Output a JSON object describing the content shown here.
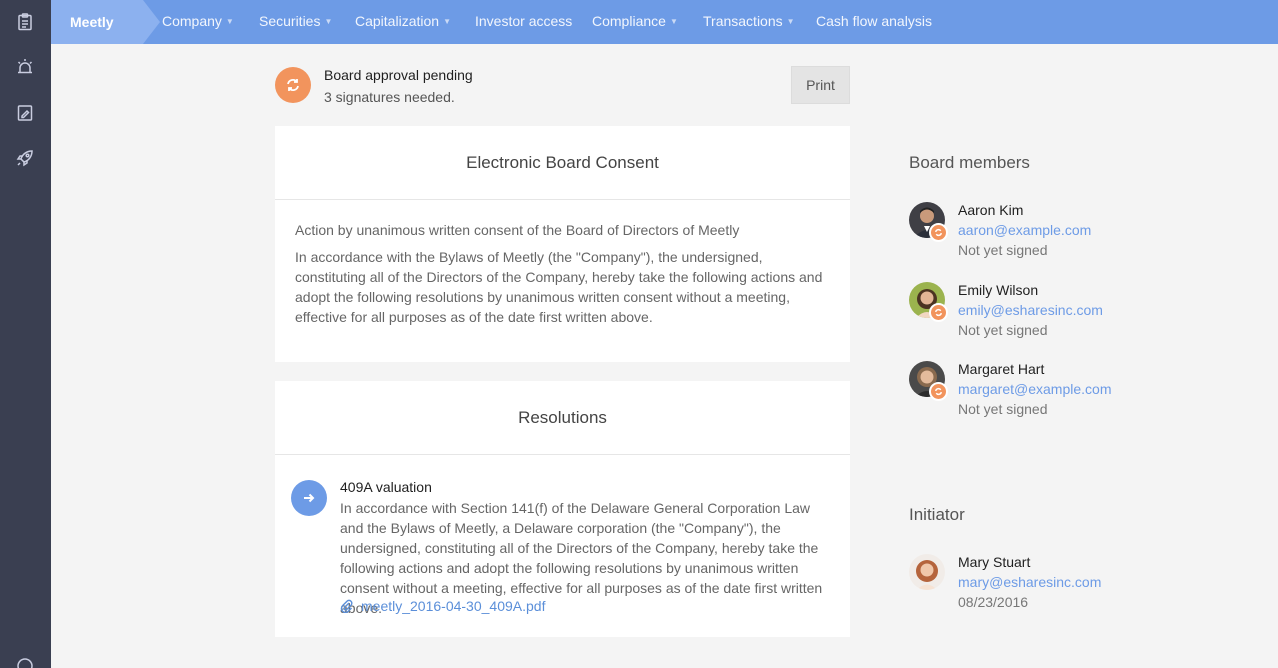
{
  "nav": {
    "brand": "Meetly",
    "items": [
      {
        "label": "Company",
        "dropdown": true
      },
      {
        "label": "Securities",
        "dropdown": true
      },
      {
        "label": "Capitalization",
        "dropdown": true
      },
      {
        "label": "Investor access",
        "dropdown": false
      },
      {
        "label": "Compliance",
        "dropdown": true
      },
      {
        "label": "Transactions",
        "dropdown": true
      },
      {
        "label": "Cash flow analysis",
        "dropdown": false
      }
    ]
  },
  "sidebar": {
    "icons": [
      "clipboard-icon",
      "alarm-icon",
      "document-edit-icon",
      "rocket-icon"
    ]
  },
  "alert": {
    "title": "Board approval pending",
    "subtitle": "3 signatures needed.",
    "print_label": "Print"
  },
  "consent": {
    "title": "Electronic Board Consent",
    "intro": "Action by unanimous written consent of the Board of Directors of Meetly",
    "body": "In accordance with the Bylaws of Meetly (the \"Company\"), the undersigned, constituting all of the Directors of the Company, hereby take the following actions and adopt the following resolutions by unanimous written consent without a meeting, effective for all purposes as of the date first written above."
  },
  "resolutions": {
    "title": "Resolutions",
    "items": [
      {
        "title": "409A valuation",
        "text": "In accordance with Section 141(f) of the Delaware General Corporation Law and the Bylaws of Meetly, a Delaware corporation (the \"Company\"), the undersigned, constituting all of the Directors of the Company, hereby take the following actions and adopt the following resolutions by unanimous written consent without a meeting, effective for all purposes as of the date first written above.",
        "attachment": "meetly_2016-04-30_409A.pdf"
      }
    ]
  },
  "board": {
    "heading": "Board members",
    "members": [
      {
        "name": "Aaron Kim",
        "email": "aaron@example.com",
        "status": "Not yet signed"
      },
      {
        "name": "Emily Wilson",
        "email": "emily@esharesinc.com",
        "status": "Not yet signed"
      },
      {
        "name": "Margaret Hart",
        "email": "margaret@example.com",
        "status": "Not yet signed"
      }
    ]
  },
  "initiator": {
    "heading": "Initiator",
    "name": "Mary Stuart",
    "email": "mary@esharesinc.com",
    "date": "08/23/2016"
  },
  "colors": {
    "nav_bg": "#6d9be6",
    "sidebar_bg": "#3a3f51",
    "pending_orange": "#f2945d",
    "link_blue": "#6d9be6"
  }
}
